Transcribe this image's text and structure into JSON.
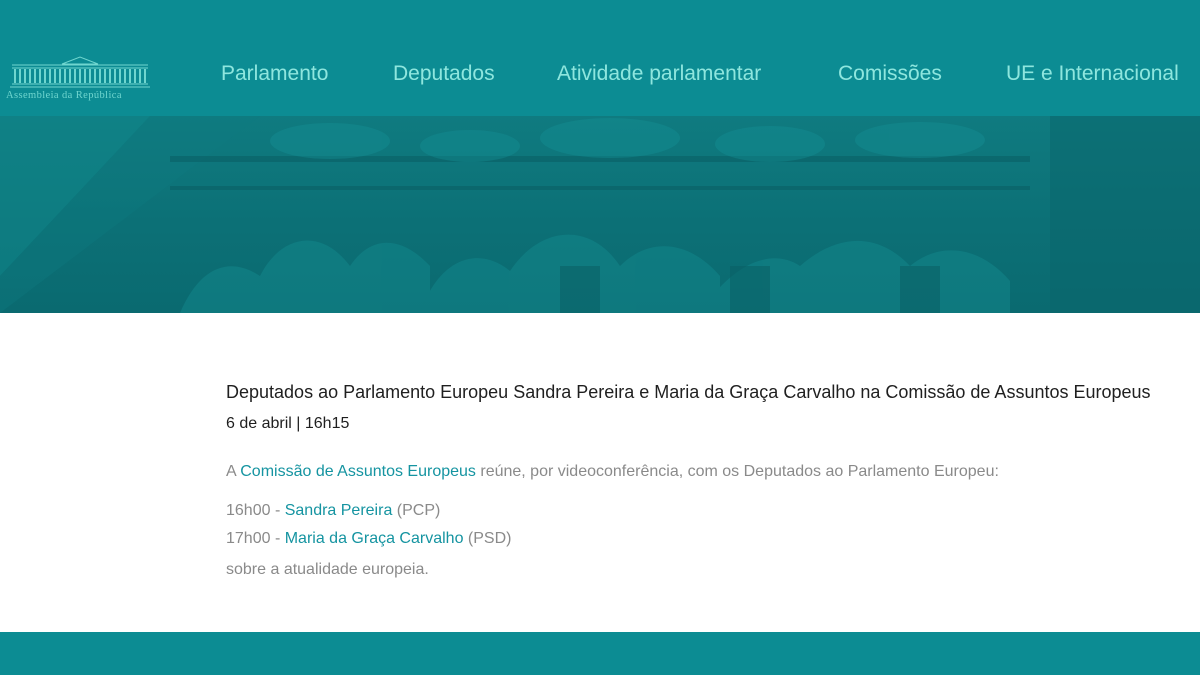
{
  "header": {
    "logo_text": "Assembleia da República",
    "nav": [
      {
        "label": "Parlamento"
      },
      {
        "label": "Deputados"
      },
      {
        "label": "Atividade parlamentar"
      },
      {
        "label": "Comissões"
      },
      {
        "label": "UE e Internacional"
      }
    ]
  },
  "article": {
    "title": "Deputados ao Parlamento Europeu Sandra Pereira e Maria da Graça Carvalho na Comissão de Assuntos Europeus",
    "date": "6 de abril | 16h15",
    "intro": {
      "prefix": "A ",
      "committee_link": "Comissão de Assuntos Europeus",
      "suffix": " reúne, por videoconferência, com os Deputados ao Parlamento Europeu:"
    },
    "schedule": [
      {
        "time": "16h00 - ",
        "name": "Sandra Pereira",
        "party": " (PCP)"
      },
      {
        "time": "17h00 - ",
        "name": "Maria da Graça Carvalho",
        "party": " (PSD)"
      }
    ],
    "outro": "sobre a atualidade europeia."
  },
  "colors": {
    "header_bg": "#0c8c93",
    "nav_text": "#8ee6de",
    "link": "#1594a1",
    "body_text": "#8a8a8a",
    "heading_text": "#1f1f1f"
  }
}
